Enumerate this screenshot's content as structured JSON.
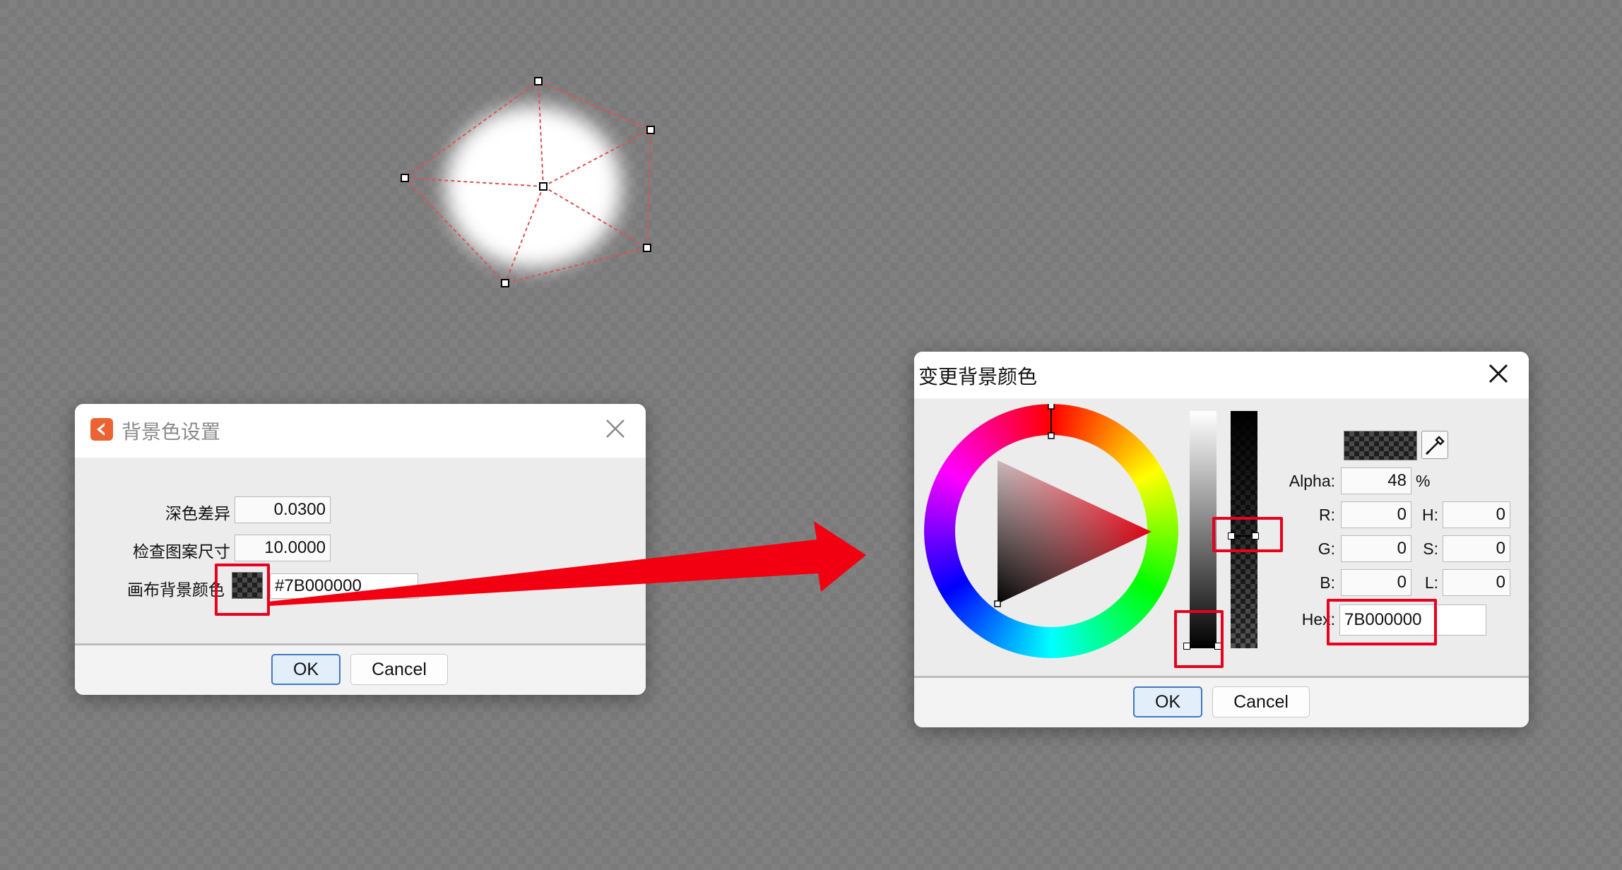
{
  "settings_dialog": {
    "title": "背景色设置",
    "dark_diff_label": "深色差异",
    "dark_diff_value": "0.0300",
    "pattern_size_label": "检查图案尺寸",
    "pattern_size_value": "10.0000",
    "canvas_bg_label": "画布背景颜色",
    "canvas_bg_value": "#7B000000",
    "ok_label": "OK",
    "cancel_label": "Cancel"
  },
  "color_dialog": {
    "title": "变更背景颜色",
    "alpha_label": "Alpha:",
    "alpha_value": "48",
    "alpha_unit": "%",
    "r_label": "R:",
    "r_value": "0",
    "g_label": "G:",
    "g_value": "0",
    "b_label": "B:",
    "b_value": "0",
    "h_label": "H:",
    "h_value": "0",
    "s_label": "S:",
    "s_value": "0",
    "l_label": "L:",
    "l_value": "0",
    "hex_label": "Hex:",
    "hex_value": "7B000000",
    "ok_label": "OK",
    "cancel_label": "Cancel"
  },
  "icons": {
    "app": "app-logo-icon",
    "close": "close-icon",
    "eyedropper": "eyedropper-icon",
    "arrow": "red-arrow"
  },
  "colors": {
    "highlight_red": "#e8001c",
    "mesh_line": "#e05050",
    "ok_border": "#3f78c6"
  }
}
